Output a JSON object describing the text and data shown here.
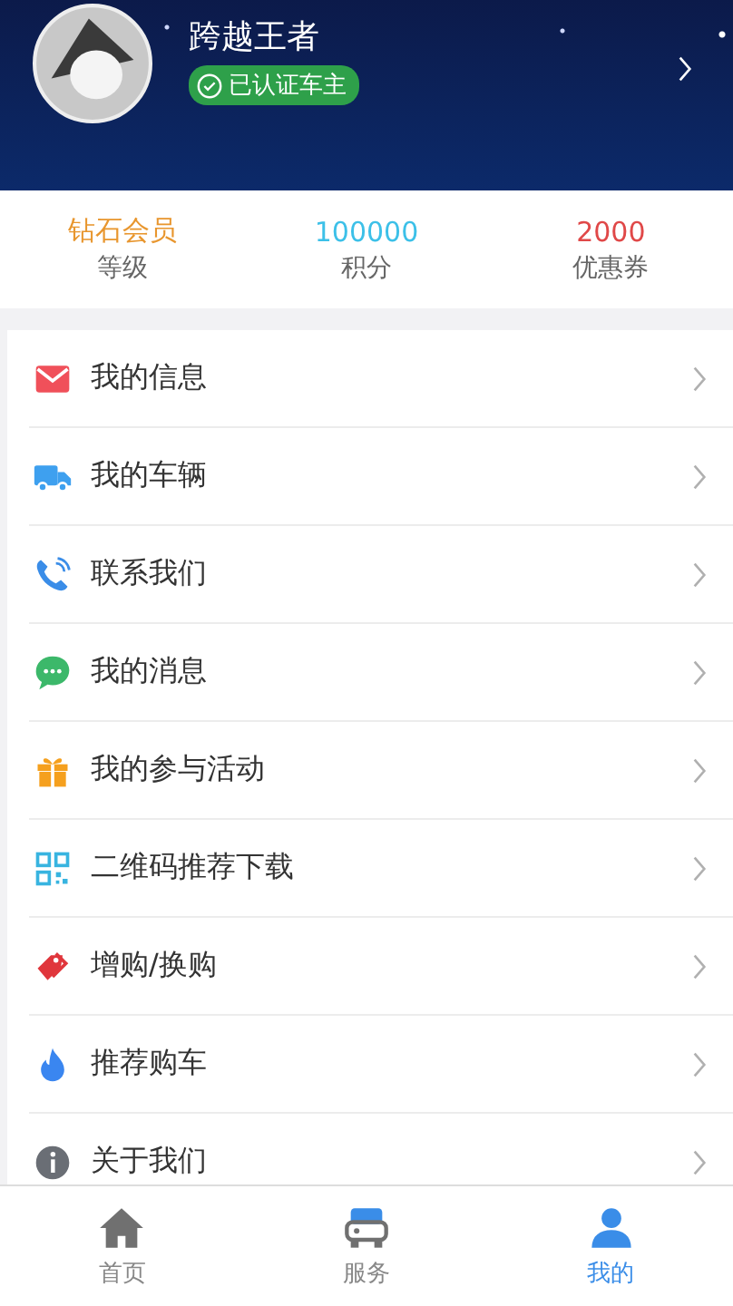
{
  "profile": {
    "name": "跨越王者",
    "badge": "已认证车主"
  },
  "stats": [
    {
      "value": "钻石会员",
      "label": "等级",
      "color": "#e8962e"
    },
    {
      "value": "100000",
      "label": "积分",
      "color": "#3cc0e8"
    },
    {
      "value": "2000",
      "label": "优惠券",
      "color": "#e04848"
    }
  ],
  "menu": [
    {
      "label": "我的信息"
    },
    {
      "label": "我的车辆"
    },
    {
      "label": "联系我们"
    },
    {
      "label": "我的消息"
    },
    {
      "label": "我的参与活动"
    },
    {
      "label": "二维码推荐下载"
    },
    {
      "label": "增购/换购"
    },
    {
      "label": "推荐购车"
    },
    {
      "label": "关于我们"
    }
  ],
  "tabs": [
    {
      "label": "首页",
      "selected": false
    },
    {
      "label": "服务",
      "selected": false
    },
    {
      "label": "我的",
      "selected": true
    }
  ]
}
